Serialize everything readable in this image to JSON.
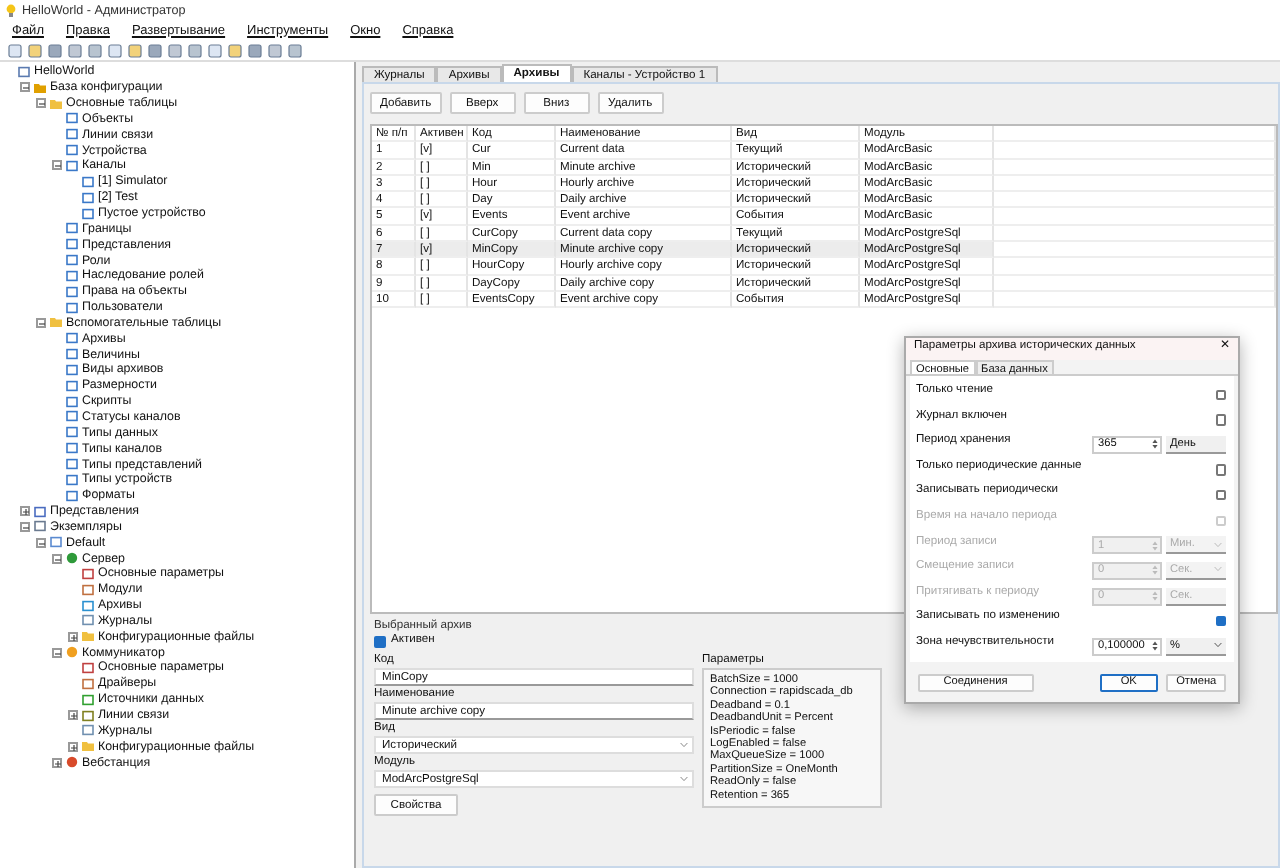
{
  "window": {
    "title": "HelloWorld - Администратор"
  },
  "menu": [
    "Файл",
    "Правка",
    "Развертывание",
    "Инструменты",
    "Окно",
    "Справка"
  ],
  "tree": [
    {
      "label": "HelloWorld",
      "kind": "app",
      "children": [
        {
          "label": "База конфигурации",
          "kind": "db",
          "expanded": true,
          "children": [
            {
              "label": "Основные таблицы",
              "kind": "folder",
              "expanded": true,
              "children": [
                {
                  "label": "Объекты",
                  "kind": "table"
                },
                {
                  "label": "Линии связи",
                  "kind": "table"
                },
                {
                  "label": "Устройства",
                  "kind": "table"
                },
                {
                  "label": "Каналы",
                  "kind": "table",
                  "expanded": true,
                  "children": [
                    {
                      "label": "[1] Simulator",
                      "kind": "table"
                    },
                    {
                      "label": "[2] Test",
                      "kind": "table"
                    },
                    {
                      "label": "Пустое устройство",
                      "kind": "table"
                    }
                  ]
                },
                {
                  "label": "Границы",
                  "kind": "table"
                },
                {
                  "label": "Представления",
                  "kind": "table"
                },
                {
                  "label": "Роли",
                  "kind": "table"
                },
                {
                  "label": "Наследование ролей",
                  "kind": "table"
                },
                {
                  "label": "Права на объекты",
                  "kind": "table"
                },
                {
                  "label": "Пользователи",
                  "kind": "table"
                }
              ]
            },
            {
              "label": "Вспомогательные таблицы",
              "kind": "folder",
              "expanded": true,
              "children": [
                {
                  "label": "Архивы",
                  "kind": "table"
                },
                {
                  "label": "Величины",
                  "kind": "table"
                },
                {
                  "label": "Виды архивов",
                  "kind": "table"
                },
                {
                  "label": "Размерности",
                  "kind": "table"
                },
                {
                  "label": "Скрипты",
                  "kind": "table"
                },
                {
                  "label": "Статусы каналов",
                  "kind": "table"
                },
                {
                  "label": "Типы данных",
                  "kind": "table"
                },
                {
                  "label": "Типы каналов",
                  "kind": "table"
                },
                {
                  "label": "Типы представлений",
                  "kind": "table"
                },
                {
                  "label": "Типы устройств",
                  "kind": "table"
                },
                {
                  "label": "Форматы",
                  "kind": "table"
                }
              ]
            }
          ]
        },
        {
          "label": "Представления",
          "kind": "views",
          "expanded": false
        },
        {
          "label": "Экземпляры",
          "kind": "instances",
          "expanded": true,
          "children": [
            {
              "label": "Default",
              "kind": "device",
              "expanded": true,
              "children": [
                {
                  "label": "Сервер",
                  "kind": "globe",
                  "expanded": true,
                  "children": [
                    {
                      "label": "Основные параметры",
                      "kind": "params"
                    },
                    {
                      "label": "Модули",
                      "kind": "modules"
                    },
                    {
                      "label": "Архивы",
                      "kind": "archive"
                    },
                    {
                      "label": "Журналы",
                      "kind": "journal"
                    },
                    {
                      "label": "Конфигурационные файлы",
                      "kind": "folder",
                      "expanded": false
                    }
                  ]
                },
                {
                  "label": "Коммуникатор",
                  "kind": "sun",
                  "expanded": true,
                  "children": [
                    {
                      "label": "Основные параметры",
                      "kind": "params"
                    },
                    {
                      "label": "Драйверы",
                      "kind": "modules"
                    },
                    {
                      "label": "Источники данных",
                      "kind": "source"
                    },
                    {
                      "label": "Линии связи",
                      "kind": "lines",
                      "expanded": false
                    },
                    {
                      "label": "Журналы",
                      "kind": "journal"
                    },
                    {
                      "label": "Конфигурационные файлы",
                      "kind": "folder",
                      "expanded": false
                    }
                  ]
                },
                {
                  "label": "Вебстанция",
                  "kind": "web",
                  "expanded": false
                }
              ]
            }
          ]
        }
      ]
    }
  ],
  "tabs": [
    {
      "label": "Журналы",
      "selected": false
    },
    {
      "label": "Архивы",
      "selected": false
    },
    {
      "label": "Архивы",
      "selected": true
    },
    {
      "label": "Каналы - Устройство 1",
      "selected": false
    }
  ],
  "buttons": [
    "Добавить",
    "Вверх",
    "Вниз",
    "Удалить"
  ],
  "table": {
    "columns": [
      "№ п/п",
      "Активен",
      "Код",
      "Наименование",
      "Вид",
      "Модуль"
    ],
    "rows": [
      {
        "cells": [
          "1",
          "[v]",
          "Cur",
          "Current data",
          "Текущий",
          "ModArcBasic"
        ],
        "selected": false
      },
      {
        "cells": [
          "2",
          "[ ]",
          "Min",
          "Minute archive",
          "Исторический",
          "ModArcBasic"
        ],
        "selected": false
      },
      {
        "cells": [
          "3",
          "[ ]",
          "Hour",
          "Hourly archive",
          "Исторический",
          "ModArcBasic"
        ],
        "selected": false
      },
      {
        "cells": [
          "4",
          "[ ]",
          "Day",
          "Daily archive",
          "Исторический",
          "ModArcBasic"
        ],
        "selected": false
      },
      {
        "cells": [
          "5",
          "[v]",
          "Events",
          "Event archive",
          "События",
          "ModArcBasic"
        ],
        "selected": false
      },
      {
        "cells": [
          "6",
          "[ ]",
          "CurCopy",
          "Current data copy",
          "Текущий",
          "ModArcPostgreSql"
        ],
        "selected": false
      },
      {
        "cells": [
          "7",
          "[v]",
          "MinCopy",
          "Minute archive copy",
          "Исторический",
          "ModArcPostgreSql"
        ],
        "selected": true
      },
      {
        "cells": [
          "8",
          "[ ]",
          "HourCopy",
          "Hourly archive copy",
          "Исторический",
          "ModArcPostgreSql"
        ],
        "selected": false
      },
      {
        "cells": [
          "9",
          "[ ]",
          "DayCopy",
          "Daily archive copy",
          "Исторический",
          "ModArcPostgreSql"
        ],
        "selected": false
      },
      {
        "cells": [
          "10",
          "[ ]",
          "EventsCopy",
          "Event archive copy",
          "События",
          "ModArcPostgreSql"
        ],
        "selected": false
      }
    ]
  },
  "selected_archive": {
    "title": "Выбранный архив",
    "active_label": "Активен",
    "active": true,
    "code_label": "Код",
    "code": "MinCopy",
    "name_label": "Наименование",
    "name": "Minute archive copy",
    "kind_label": "Вид",
    "kind": "Исторический",
    "module_label": "Модуль",
    "module": "ModArcPostgreSql",
    "properties_button": "Свойства",
    "params_label": "Параметры",
    "params": [
      "BatchSize = 1000",
      "Connection = rapidscada_db",
      "Deadband = 0.1",
      "DeadbandUnit = Percent",
      "IsPeriodic = false",
      "LogEnabled = false",
      "MaxQueueSize = 1000",
      "PartitionSize = OneMonth",
      "ReadOnly = false",
      "Retention = 365"
    ]
  },
  "dialog": {
    "title": "Параметры архива исторических данных",
    "close": "✕",
    "tabs": [
      {
        "label": "Основные",
        "selected": true
      },
      {
        "label": "База данных",
        "selected": false
      }
    ],
    "rows": [
      {
        "kind": "check",
        "label": "Только чтение",
        "checked": false,
        "disabled": false
      },
      {
        "kind": "check",
        "label": "Журнал включен",
        "checked": false,
        "disabled": false
      },
      {
        "kind": "spin",
        "label": "Период хранения",
        "value": "365",
        "unit": "День",
        "dropdown": false,
        "disabled": false
      },
      {
        "kind": "check",
        "label": "Только периодические данные",
        "checked": false,
        "disabled": false
      },
      {
        "kind": "check",
        "label": "Записывать периодически",
        "checked": false,
        "disabled": false
      },
      {
        "kind": "check",
        "label": "Время на начало периода",
        "checked": false,
        "disabled": true
      },
      {
        "kind": "spin",
        "label": "Период записи",
        "value": "1",
        "unit": "Мин.",
        "dropdown": true,
        "disabled": true
      },
      {
        "kind": "spin",
        "label": "Смещение записи",
        "value": "0",
        "unit": "Сек.",
        "dropdown": true,
        "disabled": true
      },
      {
        "kind": "spin",
        "label": "Притягивать к периоду",
        "value": "0",
        "unit": "Сек.",
        "dropdown": false,
        "disabled": true
      },
      {
        "kind": "check",
        "label": "Записывать по изменению",
        "checked": true,
        "disabled": false
      },
      {
        "kind": "spin",
        "label": "Зона нечувствительности",
        "value": "0,100000",
        "unit": "%",
        "dropdown": true,
        "disabled": false
      }
    ],
    "buttons": [
      {
        "label": "Соединения",
        "kind": "left"
      },
      {
        "label": "OK",
        "kind": "default"
      },
      {
        "label": "Отмена",
        "kind": "normal"
      }
    ]
  }
}
